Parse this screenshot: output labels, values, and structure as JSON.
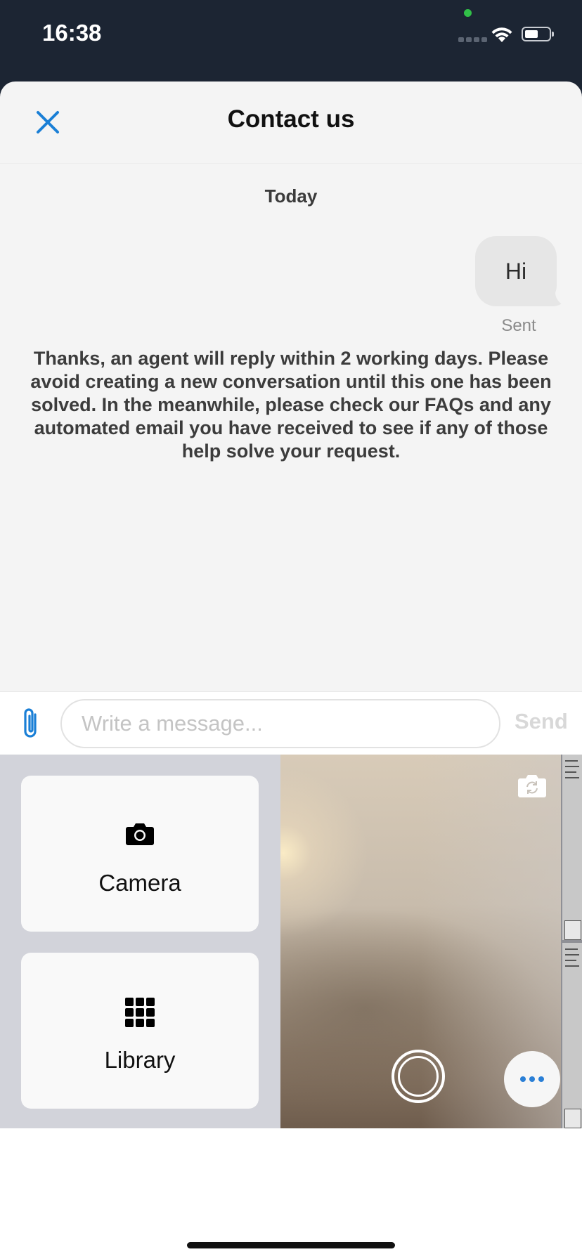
{
  "status_bar": {
    "time": "16:38"
  },
  "header": {
    "title": "Contact us",
    "close_icon": "close-icon"
  },
  "conversation": {
    "day_label": "Today",
    "messages": [
      {
        "from": "user",
        "text": "Hi",
        "status": "Sent"
      }
    ],
    "auto_reply": "Thanks, an agent will reply within 2 working days. Please avoid creating a new conversation until this one has been solved. In the meanwhile, please check our FAQs and any automated email you have received to see if any of those help solve your request."
  },
  "composer": {
    "attach_icon": "paperclip-icon",
    "placeholder": "Write a message...",
    "value": "",
    "send_label": "Send"
  },
  "picker": {
    "camera_label": "Camera",
    "camera_icon": "camera-icon",
    "library_label": "Library",
    "library_icon": "grid-icon",
    "flip_icon": "camera-flip-icon",
    "shutter_icon": "shutter-icon",
    "more_icon": "more-dots-icon"
  },
  "colors": {
    "accent": "#1a7fd6",
    "status_bar": "#1c2533",
    "sheet_background": "#f4f4f4"
  }
}
